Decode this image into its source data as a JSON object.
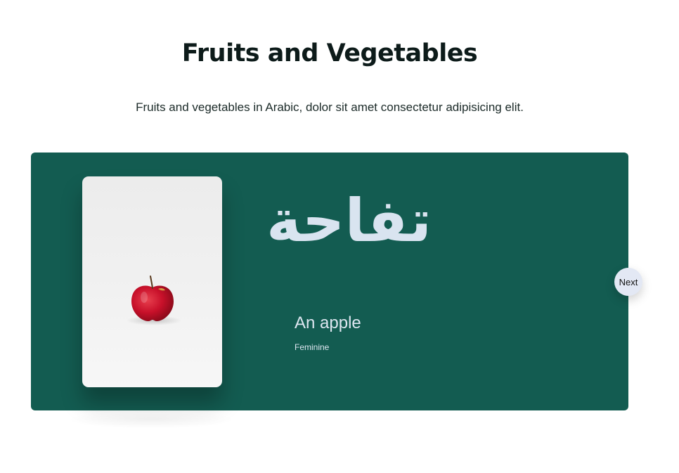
{
  "header": {
    "title": "Fruits and Vegetables",
    "subtitle": "Fruits and vegetables in Arabic, dolor sit amet consectetur adipisicing elit."
  },
  "card": {
    "image_icon": "apple-image",
    "arabic_word": "تفاحة",
    "translation": "An apple",
    "gender": "Feminine",
    "colors": {
      "background": "#135c51",
      "text": "#d9e4f0"
    }
  },
  "navigation": {
    "next_label": "Next"
  }
}
